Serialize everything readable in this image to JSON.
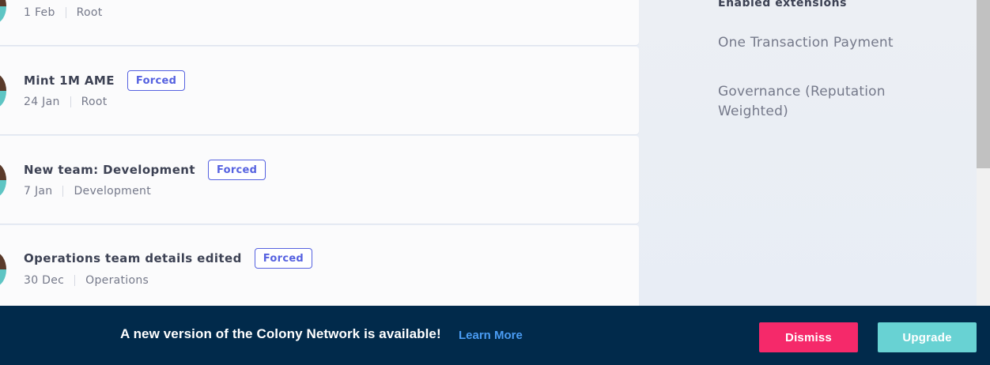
{
  "feed": {
    "items": [
      {
        "title": "",
        "badge": "",
        "date": "1 Feb",
        "domain": "Root"
      },
      {
        "title": "Mint 1M AME",
        "badge": "Forced",
        "date": "24 Jan",
        "domain": "Root"
      },
      {
        "title": "New team: Development",
        "badge": "Forced",
        "date": "7 Jan",
        "domain": "Development"
      },
      {
        "title": "Operations team details edited",
        "badge": "Forced",
        "date": "30 Dec",
        "domain": "Operations"
      }
    ]
  },
  "sidebar": {
    "heading": "Enabled extensions",
    "extensions": [
      {
        "label": "One Transaction Payment"
      },
      {
        "label": "Governance (Reputation Weighted)"
      }
    ]
  },
  "banner": {
    "message": "A new version of the Colony Network is available!",
    "link_label": "Learn More",
    "dismiss_label": "Dismiss",
    "upgrade_label": "Upgrade"
  },
  "colors": {
    "badge_accent": "#5662e0",
    "banner_bg": "#012a4b",
    "dismiss": "#f5296a",
    "upgrade": "#68d2d3",
    "link": "#4a9cf3"
  }
}
